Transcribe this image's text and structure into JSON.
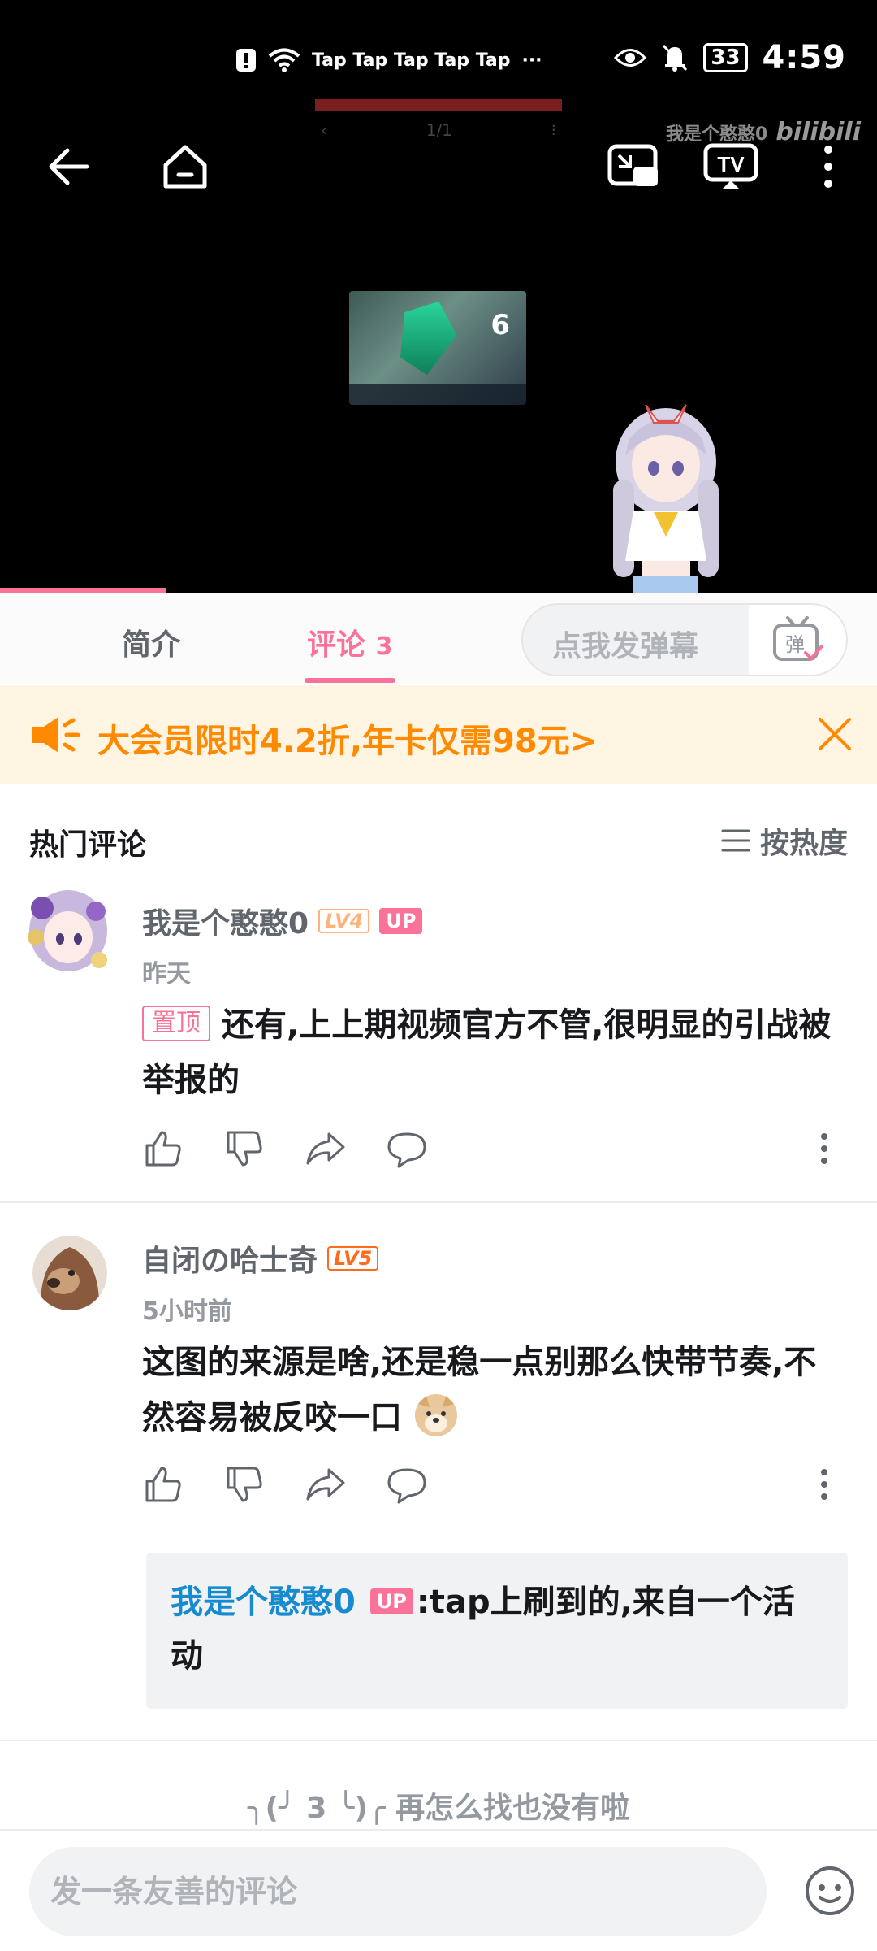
{
  "status_bar": {
    "notif_text": "Tap Tap Tap Tap Tap",
    "more": "···",
    "battery": "33",
    "time": "4:59"
  },
  "video": {
    "watermark_user": "我是个憨憨0",
    "watermark_brand": "bilibili",
    "page_indicator": "1/1",
    "thumb_number": "6",
    "progress_fraction": 0.19
  },
  "tabs": {
    "intro": "简介",
    "comments": "评论",
    "comments_count": "3",
    "danmaku_placeholder": "点我发弹幕",
    "danmaku_button": "弹"
  },
  "promo": {
    "text": "大会员限时4.2折,年卡仅需98元>"
  },
  "comments_section": {
    "title": "热门评论",
    "sort_label": "按热度"
  },
  "comments": [
    {
      "user": "我是个憨憨0",
      "level": "LV4",
      "up": "UP",
      "time": "昨天",
      "pin": "置顶",
      "text": "还有,上上期视频官方不管,很明显的引战被举报的"
    },
    {
      "user": "自闭の哈士奇",
      "level": "LV5",
      "time": "5小时前",
      "text": "这图的来源是啥,还是稳一点别那么快带节奏,不然容易被反咬一口",
      "reply": {
        "user": "我是个憨憨0",
        "up": "UP",
        "text": ":tap上刷到的,来自一个活动"
      }
    }
  ],
  "end_note": {
    "count": "3",
    "text": "再怎么找也没有啦"
  },
  "bottom": {
    "input_placeholder": "发一条友善的评论"
  },
  "colors": {
    "accent": "#fb7299",
    "promo": "#ff8a00",
    "reply_name": "#178bcf"
  }
}
